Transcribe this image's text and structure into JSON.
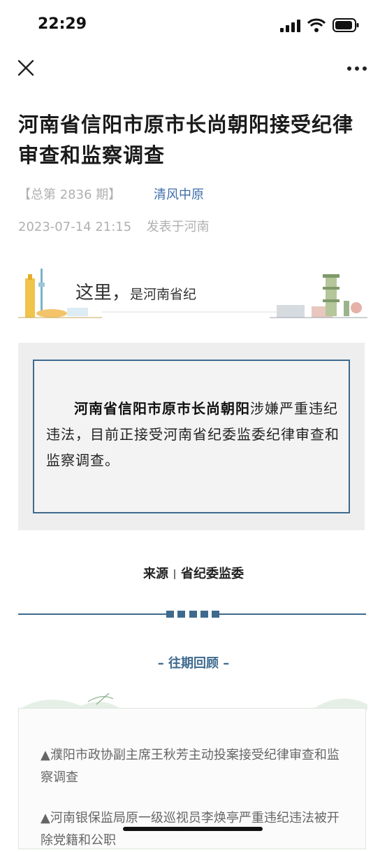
{
  "status_bar": {
    "time": "22:29"
  },
  "nav": {
    "close_icon": "close-icon",
    "more_icon": "more-icon"
  },
  "article": {
    "title": "河南省信阳市原市长尚朝阳接受纪律审查和监察调查",
    "issue": "【总第 2836 期】",
    "account": "清风中原",
    "date": "2023-07-14 21:15",
    "location": "发表于河南"
  },
  "banner": {
    "text_big": "这里，",
    "text_small": "是河南省纪"
  },
  "content": {
    "bold_name": "河南省信阳市原市长尚朝阳",
    "rest": "涉嫌严重违纪违法，目前正接受河南省纪委监委纪律审查和监察调查。"
  },
  "source": {
    "label": "来源",
    "value": "省纪委监委"
  },
  "past": {
    "heading": "– 往期回顾 –",
    "items": [
      "▲濮阳市政协副主席王秋芳主动投案接受纪律审查和监察调查",
      "▲河南银保监局原一级巡视员李焕亭严重违纪违法被开除党籍和公职"
    ]
  },
  "colors": {
    "accent": "#3e6a8e",
    "link": "#3f6ea8"
  }
}
